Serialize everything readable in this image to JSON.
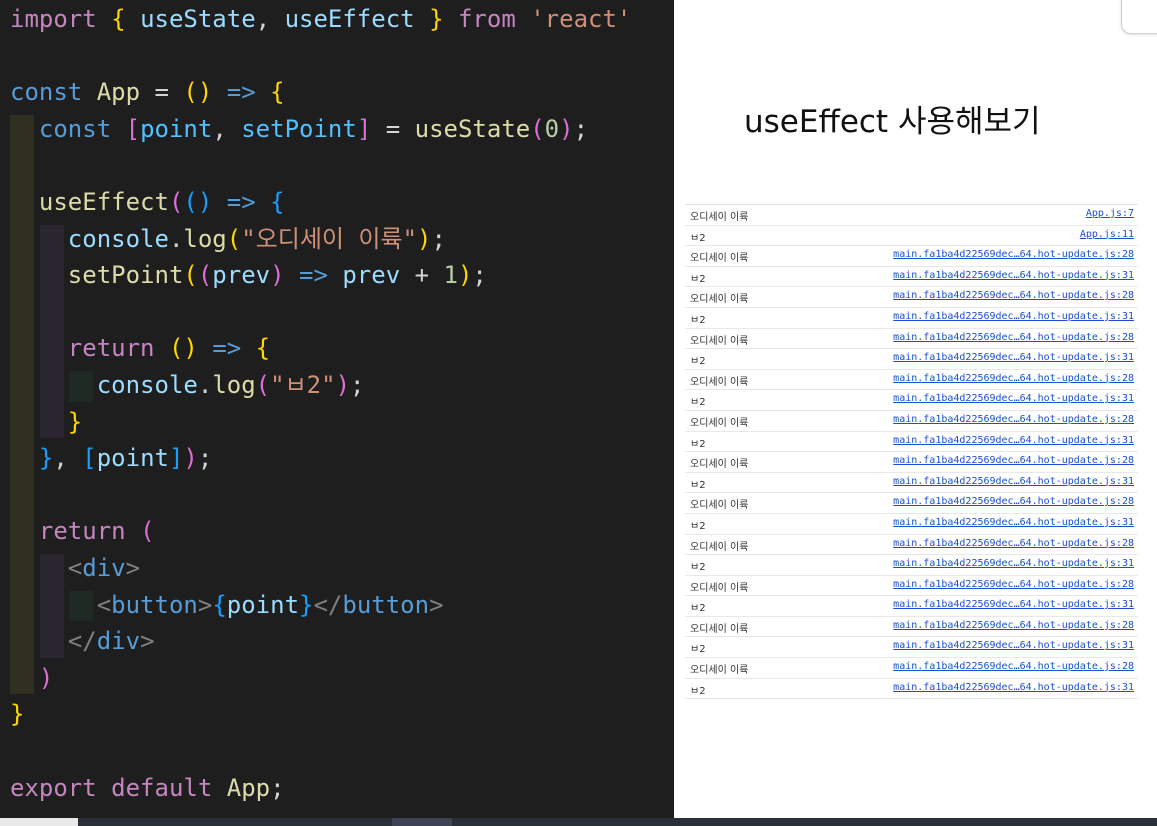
{
  "editor": {
    "lines": [
      [
        [
          "kw",
          "import"
        ],
        [
          "pu",
          " "
        ],
        [
          "b1",
          "{"
        ],
        [
          "pu",
          " "
        ],
        [
          "var",
          "useState"
        ],
        [
          "pu",
          ", "
        ],
        [
          "var",
          "useEffect"
        ],
        [
          "pu",
          " "
        ],
        [
          "b1",
          "}"
        ],
        [
          "pu",
          " "
        ],
        [
          "kw",
          "from"
        ],
        [
          "pu",
          " "
        ],
        [
          "str",
          "'react'"
        ]
      ],
      [],
      [
        [
          "dc",
          "const"
        ],
        [
          "pu",
          " "
        ],
        [
          "fn",
          "App"
        ],
        [
          "pu",
          " = "
        ],
        [
          "b1",
          "()"
        ],
        [
          "pu",
          " "
        ],
        [
          "dc",
          "=>"
        ],
        [
          "pu",
          " "
        ],
        [
          "b1",
          "{"
        ]
      ],
      [
        [
          "pu",
          "  "
        ],
        [
          "dc",
          "const"
        ],
        [
          "pu",
          " "
        ],
        [
          "b2",
          "["
        ],
        [
          "cst",
          "point"
        ],
        [
          "pu",
          ", "
        ],
        [
          "cst",
          "setPoint"
        ],
        [
          "b2",
          "]"
        ],
        [
          "pu",
          " = "
        ],
        [
          "fn",
          "useState"
        ],
        [
          "b2",
          "("
        ],
        [
          "num",
          "0"
        ],
        [
          "b2",
          ")"
        ],
        [
          "pu",
          ";"
        ]
      ],
      [],
      [
        [
          "pu",
          "  "
        ],
        [
          "fn",
          "useEffect"
        ],
        [
          "b2",
          "("
        ],
        [
          "b3",
          "()"
        ],
        [
          "pu",
          " "
        ],
        [
          "dc",
          "=>"
        ],
        [
          "pu",
          " "
        ],
        [
          "b3",
          "{"
        ]
      ],
      [
        [
          "pu",
          "    "
        ],
        [
          "var",
          "console"
        ],
        [
          "pu",
          "."
        ],
        [
          "fn",
          "log"
        ],
        [
          "b1",
          "("
        ],
        [
          "str",
          "\"오디세이 이륙\""
        ],
        [
          "b1",
          ")"
        ],
        [
          "pu",
          ";"
        ]
      ],
      [
        [
          "pu",
          "    "
        ],
        [
          "fn",
          "setPoint"
        ],
        [
          "b1",
          "("
        ],
        [
          "b2",
          "("
        ],
        [
          "var",
          "prev"
        ],
        [
          "b2",
          ")"
        ],
        [
          "pu",
          " "
        ],
        [
          "dc",
          "=>"
        ],
        [
          "pu",
          " "
        ],
        [
          "var",
          "prev"
        ],
        [
          "pu",
          " + "
        ],
        [
          "num",
          "1"
        ],
        [
          "b1",
          ")"
        ],
        [
          "pu",
          ";"
        ]
      ],
      [],
      [
        [
          "pu",
          "    "
        ],
        [
          "kw",
          "return"
        ],
        [
          "pu",
          " "
        ],
        [
          "b1",
          "()"
        ],
        [
          "pu",
          " "
        ],
        [
          "dc",
          "=>"
        ],
        [
          "pu",
          " "
        ],
        [
          "b1",
          "{"
        ]
      ],
      [
        [
          "pu",
          "      "
        ],
        [
          "var",
          "console"
        ],
        [
          "pu",
          "."
        ],
        [
          "fn",
          "log"
        ],
        [
          "b2",
          "("
        ],
        [
          "str",
          "\"ㅂ2\""
        ],
        [
          "b2",
          ")"
        ],
        [
          "pu",
          ";"
        ]
      ],
      [
        [
          "pu",
          "    "
        ],
        [
          "b1",
          "}"
        ]
      ],
      [
        [
          "pu",
          "  "
        ],
        [
          "b3",
          "}"
        ],
        [
          "pu",
          ", "
        ],
        [
          "b3",
          "["
        ],
        [
          "var",
          "point"
        ],
        [
          "b3",
          "]"
        ],
        [
          "b2",
          ")"
        ],
        [
          "pu",
          ";"
        ]
      ],
      [],
      [
        [
          "pu",
          "  "
        ],
        [
          "kw",
          "return"
        ],
        [
          "pu",
          " "
        ],
        [
          "b2",
          "("
        ]
      ],
      [
        [
          "pu",
          "    "
        ],
        [
          "tg",
          "<"
        ],
        [
          "dc",
          "div"
        ],
        [
          "tg",
          ">"
        ]
      ],
      [
        [
          "pu",
          "      "
        ],
        [
          "tg",
          "<"
        ],
        [
          "dc",
          "button"
        ],
        [
          "tg",
          ">"
        ],
        [
          "b3",
          "{"
        ],
        [
          "var",
          "point"
        ],
        [
          "b3",
          "}"
        ],
        [
          "tg",
          "</"
        ],
        [
          "dc",
          "button"
        ],
        [
          "tg",
          ">"
        ]
      ],
      [
        [
          "pu",
          "    "
        ],
        [
          "tg",
          "</"
        ],
        [
          "dc",
          "div"
        ],
        [
          "tg",
          ">"
        ]
      ],
      [
        [
          "pu",
          "  "
        ],
        [
          "b2",
          ")"
        ]
      ],
      [
        [
          "b1",
          "}"
        ]
      ],
      [],
      [
        [
          "kw",
          "export"
        ],
        [
          "pu",
          " "
        ],
        [
          "kw",
          "default"
        ],
        [
          "pu",
          " "
        ],
        [
          "fn",
          "App"
        ],
        [
          "pu",
          ";"
        ]
      ]
    ]
  },
  "pane": {
    "heading": "useEffect 사용해보기"
  },
  "console": {
    "rows": [
      {
        "msg": "오디세이 이륙",
        "src": "App.js:7"
      },
      {
        "msg": "ㅂ2",
        "src": "App.js:11"
      },
      {
        "msg": "오디세이 이륙",
        "src": "main.fa1ba4d22569dec…64.hot-update.js:28"
      },
      {
        "msg": "ㅂ2",
        "src": "main.fa1ba4d22569dec…64.hot-update.js:31"
      },
      {
        "msg": "오디세이 이륙",
        "src": "main.fa1ba4d22569dec…64.hot-update.js:28"
      },
      {
        "msg": "ㅂ2",
        "src": "main.fa1ba4d22569dec…64.hot-update.js:31"
      },
      {
        "msg": "오디세이 이륙",
        "src": "main.fa1ba4d22569dec…64.hot-update.js:28"
      },
      {
        "msg": "ㅂ2",
        "src": "main.fa1ba4d22569dec…64.hot-update.js:31"
      },
      {
        "msg": "오디세이 이륙",
        "src": "main.fa1ba4d22569dec…64.hot-update.js:28"
      },
      {
        "msg": "ㅂ2",
        "src": "main.fa1ba4d22569dec…64.hot-update.js:31"
      },
      {
        "msg": "오디세이 이륙",
        "src": "main.fa1ba4d22569dec…64.hot-update.js:28"
      },
      {
        "msg": "ㅂ2",
        "src": "main.fa1ba4d22569dec…64.hot-update.js:31"
      },
      {
        "msg": "오디세이 이륙",
        "src": "main.fa1ba4d22569dec…64.hot-update.js:28"
      },
      {
        "msg": "ㅂ2",
        "src": "main.fa1ba4d22569dec…64.hot-update.js:31"
      },
      {
        "msg": "오디세이 이륙",
        "src": "main.fa1ba4d22569dec…64.hot-update.js:28"
      },
      {
        "msg": "ㅂ2",
        "src": "main.fa1ba4d22569dec…64.hot-update.js:31"
      },
      {
        "msg": "오디세이 이륙",
        "src": "main.fa1ba4d22569dec…64.hot-update.js:28"
      },
      {
        "msg": "ㅂ2",
        "src": "main.fa1ba4d22569dec…64.hot-update.js:31"
      },
      {
        "msg": "오디세이 이륙",
        "src": "main.fa1ba4d22569dec…64.hot-update.js:28"
      },
      {
        "msg": "ㅂ2",
        "src": "main.fa1ba4d22569dec…64.hot-update.js:31"
      },
      {
        "msg": "오디세이 이륙",
        "src": "main.fa1ba4d22569dec…64.hot-update.js:28"
      },
      {
        "msg": "ㅂ2",
        "src": "main.fa1ba4d22569dec…64.hot-update.js:31"
      },
      {
        "msg": "오디세이 이륙",
        "src": "main.fa1ba4d22569dec…64.hot-update.js:28"
      },
      {
        "msg": "ㅂ2",
        "src": "main.fa1ba4d22569dec…64.hot-update.js:31"
      }
    ]
  }
}
